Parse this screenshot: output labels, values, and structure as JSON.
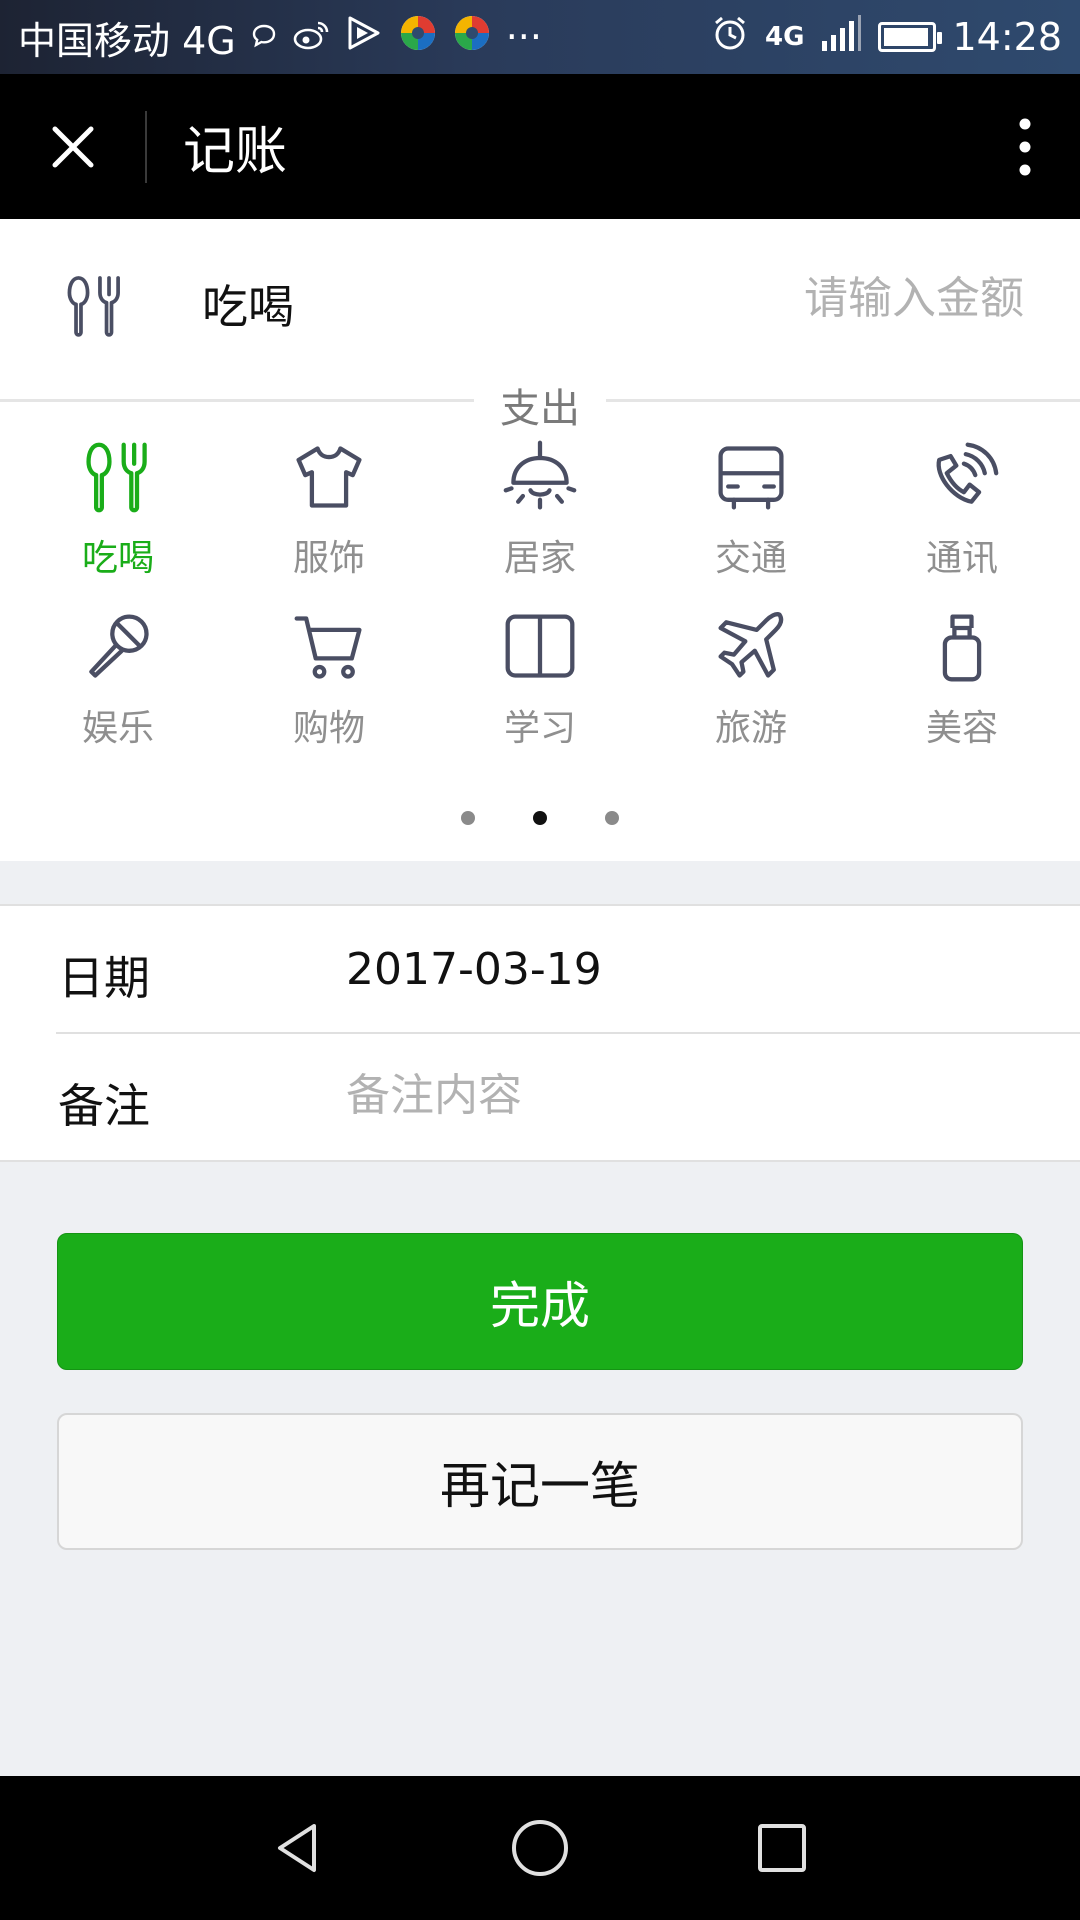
{
  "status_bar": {
    "carrier": "中国移动 4G",
    "more_indicator": "···",
    "network_top": "4G",
    "time": "14:28",
    "battery_level": 0.95,
    "icons": [
      "chat-bubble-icon",
      "weibo-icon",
      "video-play-icon",
      "app-icon",
      "app-icon",
      "alarm-icon",
      "signal-icon",
      "battery-icon"
    ]
  },
  "app_bar": {
    "title": "记账",
    "icons": [
      "close-icon",
      "more-vertical-icon"
    ]
  },
  "amount": {
    "selected_category": "吃喝",
    "icon": "fork-spoon-icon",
    "placeholder": "请输入金额"
  },
  "categories": {
    "section_label": "支出",
    "items": [
      {
        "label": "吃喝",
        "icon": "fork-spoon-icon",
        "active": true
      },
      {
        "label": "服饰",
        "icon": "tshirt-icon"
      },
      {
        "label": "居家",
        "icon": "lamp-icon"
      },
      {
        "label": "交通",
        "icon": "bus-icon"
      },
      {
        "label": "通讯",
        "icon": "phone-icon"
      },
      {
        "label": "娱乐",
        "icon": "microphone-icon"
      },
      {
        "label": "购物",
        "icon": "cart-icon"
      },
      {
        "label": "学习",
        "icon": "book-icon"
      },
      {
        "label": "旅游",
        "icon": "airplane-icon"
      },
      {
        "label": "美容",
        "icon": "bottle-icon"
      }
    ],
    "pages": 3,
    "current_page": 2
  },
  "form": {
    "date_label": "日期",
    "date_value": "2017-03-19",
    "note_label": "备注",
    "note_placeholder": "备注内容"
  },
  "buttons": {
    "done": "完成",
    "again": "再记一笔"
  },
  "colors": {
    "accent": "#1aad19",
    "icon_gray": "#4a4e63",
    "label_gray": "#8f8f8f",
    "placeholder": "#b2b2b2"
  },
  "nav_bar": {
    "icons": [
      "back-icon",
      "home-icon",
      "recents-icon"
    ]
  }
}
